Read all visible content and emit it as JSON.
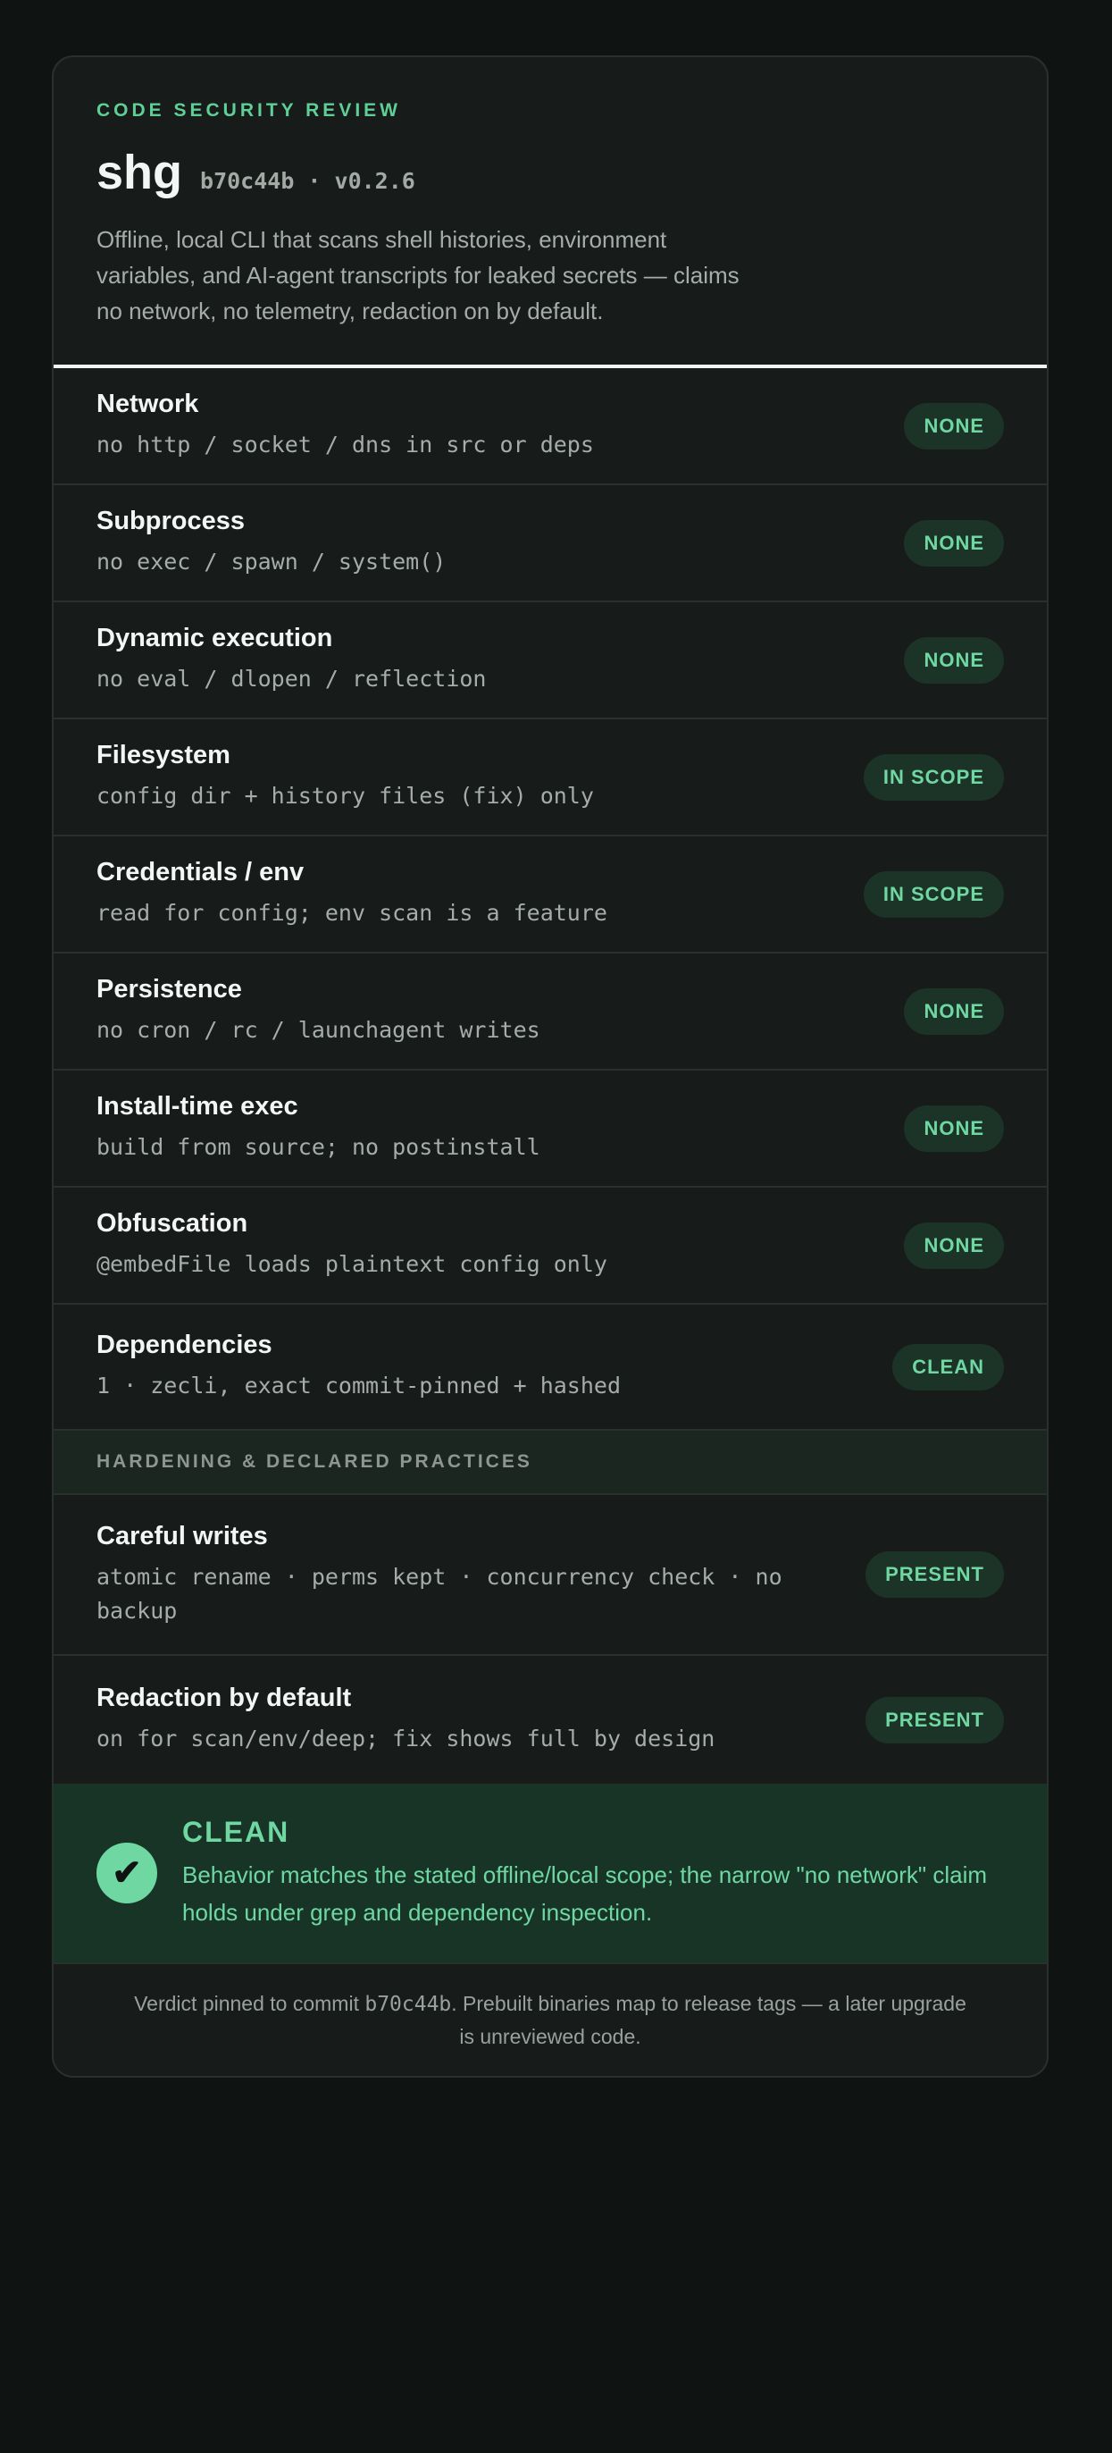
{
  "header": {
    "eyebrow": "CODE SECURITY REVIEW",
    "package": "shg",
    "version": "b70c44b · v0.2.6",
    "summary": "Offline, local CLI that scans shell histories, environment variables, and AI-agent transcripts for leaked secrets — claims no network, no telemetry, redaction on by default."
  },
  "checks": [
    {
      "name": "Network",
      "desc": "no http / socket / dns in src or deps",
      "status": "NONE"
    },
    {
      "name": "Subprocess",
      "desc": "no exec / spawn / system()",
      "status": "NONE"
    },
    {
      "name": "Dynamic execution",
      "desc": "no eval / dlopen / reflection",
      "status": "NONE"
    },
    {
      "name": "Filesystem",
      "desc": "config dir + history files (fix) only",
      "status": "IN SCOPE"
    },
    {
      "name": "Credentials / env",
      "desc": "read for config; env scan is a feature",
      "status": "IN SCOPE"
    },
    {
      "name": "Persistence",
      "desc": "no cron / rc / launchagent writes",
      "status": "NONE"
    },
    {
      "name": "Install-time exec",
      "desc": "build from source; no postinstall",
      "status": "NONE"
    },
    {
      "name": "Obfuscation",
      "desc": "@embedFile loads plaintext config only",
      "status": "NONE"
    },
    {
      "name": "Dependencies",
      "desc": "1 · zecli, exact commit-pinned + hashed",
      "status": "CLEAN"
    }
  ],
  "hardening": {
    "title": "HARDENING & DECLARED PRACTICES",
    "items": [
      {
        "name": "Careful writes",
        "desc": "atomic rename · perms kept · concurrency check · no backup",
        "status": "PRESENT"
      },
      {
        "name": "Redaction by default",
        "desc": "on for scan/env/deep; fix shows full by design",
        "status": "PRESENT"
      }
    ]
  },
  "verdict": {
    "icon": "check-icon",
    "glyph": "✔",
    "title": "CLEAN",
    "body": "Behavior matches the stated offline/local scope; the narrow \"no network\" claim holds under grep and dependency inspection."
  },
  "footer": {
    "pre": "Verdict pinned to commit ",
    "commit": "b70c44b",
    "post": ". Prebuilt binaries map to release tags — a later upgrade is unreviewed code."
  },
  "colors": {
    "accent": "#6fd7a2",
    "background": "#0f1412",
    "card": "#171b19",
    "verdict_bg": "#173427"
  }
}
